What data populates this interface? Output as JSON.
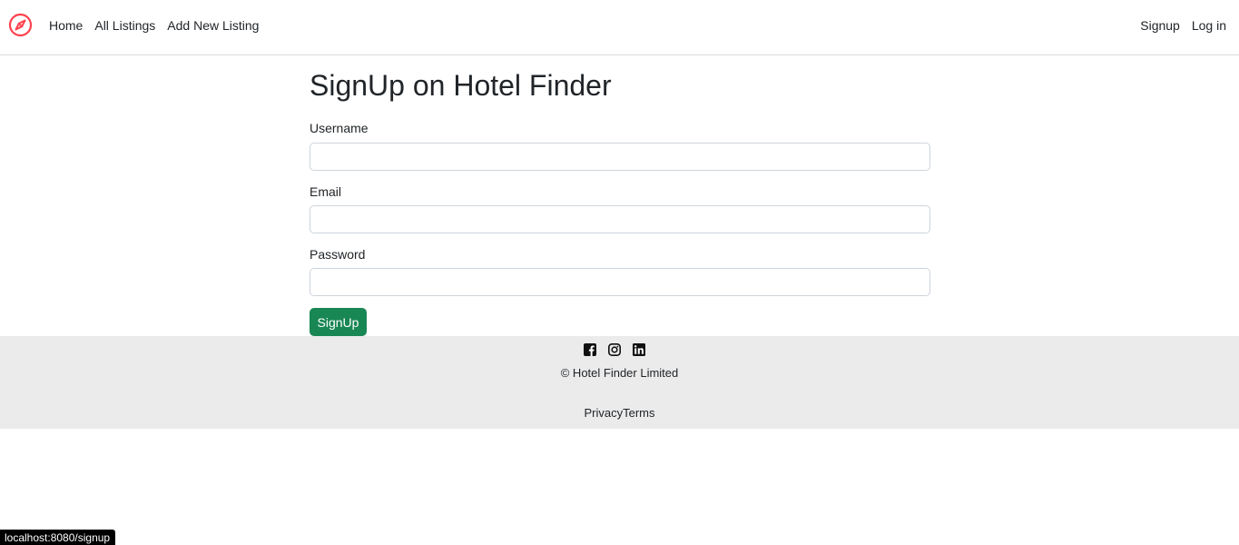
{
  "nav": {
    "brand_icon": "compass-icon",
    "brand_color": "#fe424d",
    "left_links": [
      "Home",
      "All Listings",
      "Add New Listing"
    ],
    "right_links": [
      "Signup",
      "Log in"
    ]
  },
  "form": {
    "title": "SignUp on Hotel Finder",
    "username_label": "Username",
    "username_value": "",
    "email_label": "Email",
    "email_value": "",
    "password_label": "Password",
    "password_value": "",
    "submit_label": "SignUp",
    "submit_color": "#198754"
  },
  "footer": {
    "social_icons": [
      "facebook-icon",
      "instagram-icon",
      "linkedin-icon"
    ],
    "copyright": "© Hotel Finder Limited",
    "privacy_label": "Privacy",
    "terms_label": "Terms",
    "background": "#ebebeb"
  },
  "status_bar": {
    "url": "localhost:8080/signup"
  }
}
